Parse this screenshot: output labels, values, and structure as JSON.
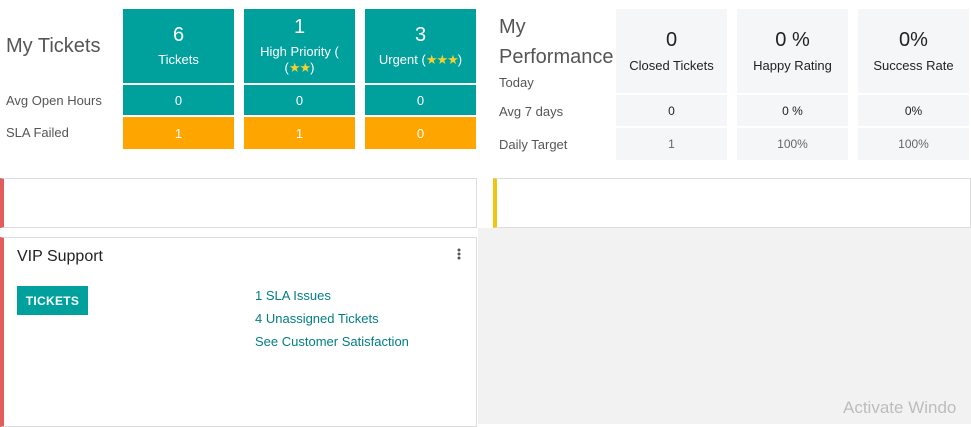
{
  "my_tickets": {
    "title": "My Tickets",
    "rows": {
      "avg_open_hours": "Avg Open Hours",
      "sla_failed": "SLA Failed"
    },
    "tiles": [
      {
        "count": "6",
        "label": "Tickets",
        "stars": "",
        "avg_open_hours": "0",
        "sla_failed": "1"
      },
      {
        "count": "1",
        "label": "High Priority (",
        "stars": "★★",
        "suffix": ")",
        "avg_open_hours": "0",
        "sla_failed": "1"
      },
      {
        "count": "3",
        "label": "Urgent (",
        "stars": "★★★",
        "suffix": ")",
        "avg_open_hours": "0",
        "sla_failed": "0"
      }
    ]
  },
  "my_performance": {
    "title_line1": "My",
    "title_line2": "Performance",
    "rows": {
      "today": "Today",
      "avg_7_days": "Avg 7 days",
      "daily_target": "Daily Target"
    },
    "tiles": [
      {
        "value": "0",
        "label": "Closed Tickets",
        "avg_7_days": "0",
        "daily_target": "1"
      },
      {
        "value": "0 %",
        "label": "Happy Rating",
        "avg_7_days": "0 %",
        "daily_target": "100%"
      },
      {
        "value": "0%",
        "label": "Success Rate",
        "avg_7_days": "0%",
        "daily_target": "100%"
      }
    ]
  },
  "vip_card": {
    "title": "VIP Support",
    "menu_icon": "vertical-ellipsis-icon",
    "button_label": "TICKETS",
    "links": [
      "1 SLA Issues",
      "4 Unassigned Tickets",
      "See Customer Satisfaction"
    ]
  },
  "colors": {
    "teal": "#00a09d",
    "orange": "#ffa500",
    "red_accent": "#e25c5c",
    "yellow_accent": "#f1c40f",
    "link": "#017e84"
  },
  "watermark": "Activate Windo"
}
